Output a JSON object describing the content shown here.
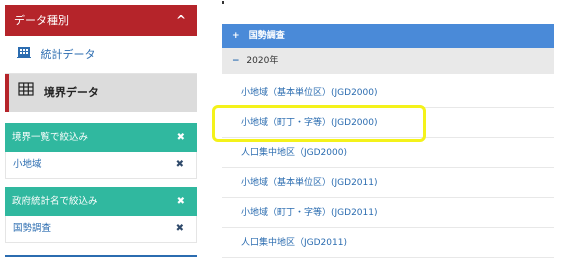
{
  "sidebar": {
    "category_header": "データ種別",
    "categories": [
      {
        "label": "統計データ",
        "icon": "building-icon"
      },
      {
        "label": "境界データ",
        "icon": "grid-icon",
        "active": true
      }
    ],
    "filters": [
      {
        "header": "境界一覧で絞込み",
        "value": "小地域"
      },
      {
        "header": "政府統計名で絞込み",
        "value": "国勢調査"
      }
    ],
    "remove_glyph": "✖",
    "collapse_glyph": "^"
  },
  "results": {
    "survey_header": "国勢調査",
    "survey_expand_glyph": "+",
    "year_label": "2020年",
    "year_collapse_glyph": "−",
    "items": [
      "小地域（基本単位区）(JGD2000)",
      "小地域（町丁・字等）(JGD2000)",
      "人口集中地区（JGD2000)",
      "小地域（基本単位区）(JGD2011)",
      "小地域（町丁・字等）(JGD2011)",
      "人口集中地区（JGD2011)"
    ],
    "highlighted_index": 1
  },
  "colors": {
    "category_header_bg": "#b5242a",
    "filter_header_bg": "#30b89f",
    "survey_header_bg": "#4a8ad8",
    "link_text": "#2b6cb0",
    "highlight_border": "#f4f21a"
  }
}
